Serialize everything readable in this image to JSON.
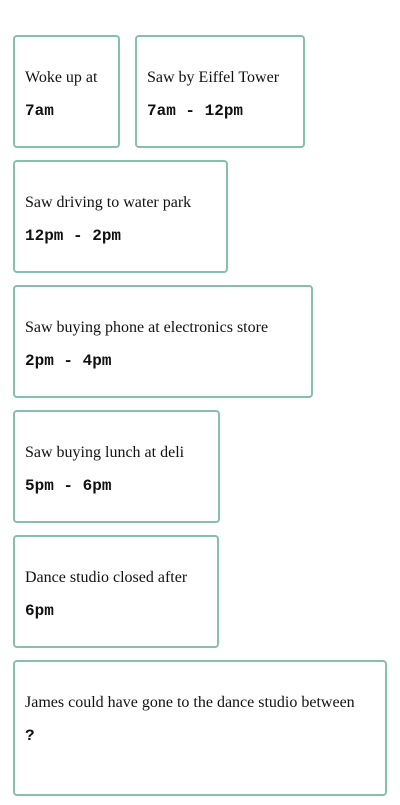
{
  "cards": [
    {
      "label": "Woke up at",
      "time": "7am"
    },
    {
      "label": "Saw by Eiffel Tower",
      "time": "7am - 12pm"
    },
    {
      "label": "Saw driving to water park",
      "time": "12pm - 2pm"
    },
    {
      "label": "Saw buying phone at electronics store",
      "time": "2pm - 4pm"
    },
    {
      "label": "Saw buying lunch at deli",
      "time": "5pm - 6pm"
    },
    {
      "label": "Dance studio closed after",
      "time": "6pm"
    },
    {
      "label": "James could have gone to the dance studio between",
      "time": "?"
    }
  ],
  "colors": {
    "card_border": "#86bfae",
    "text": "#111111",
    "background": "#ffffff"
  }
}
